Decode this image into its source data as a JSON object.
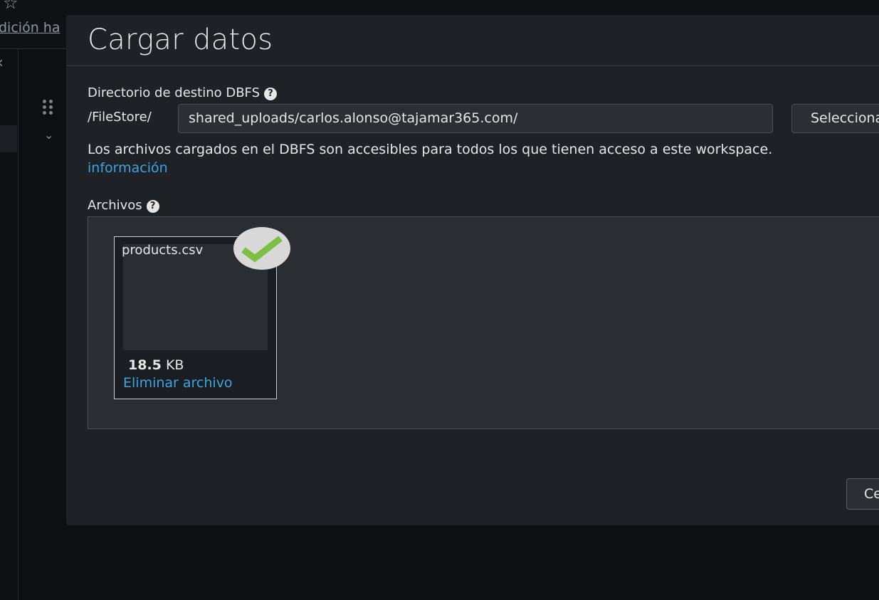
{
  "background": {
    "star_icon": "star-icon",
    "breadcrumb_link": "dición ha",
    "close_icon": "close-icon",
    "drag_icon": "drag-handle-icon",
    "chevron_icon": "chevron-down-icon"
  },
  "modal": {
    "title": "Cargar datos",
    "target_dir_label": "Directorio de destino DBFS",
    "help_glyph": "?",
    "path_prefix": "/FileStore/",
    "path_value": "shared_uploads/carlos.alonso@tajamar365.com/",
    "select_button": "Seleccionar",
    "info_text": "Los archivos cargados en el DBFS son accesibles para todos los que tienen acceso a este workspace.",
    "info_link": "información",
    "files_label": "Archivos",
    "files": [
      {
        "name": "products.csv",
        "size_value": "18.5",
        "size_unit": "KB",
        "remove_label": "Eliminar archivo",
        "status": "uploaded"
      }
    ],
    "cancel_button": "Cerrar"
  },
  "colors": {
    "modal_bg": "#1e2226",
    "link": "#3fa4e0",
    "success": "#7bc043"
  }
}
